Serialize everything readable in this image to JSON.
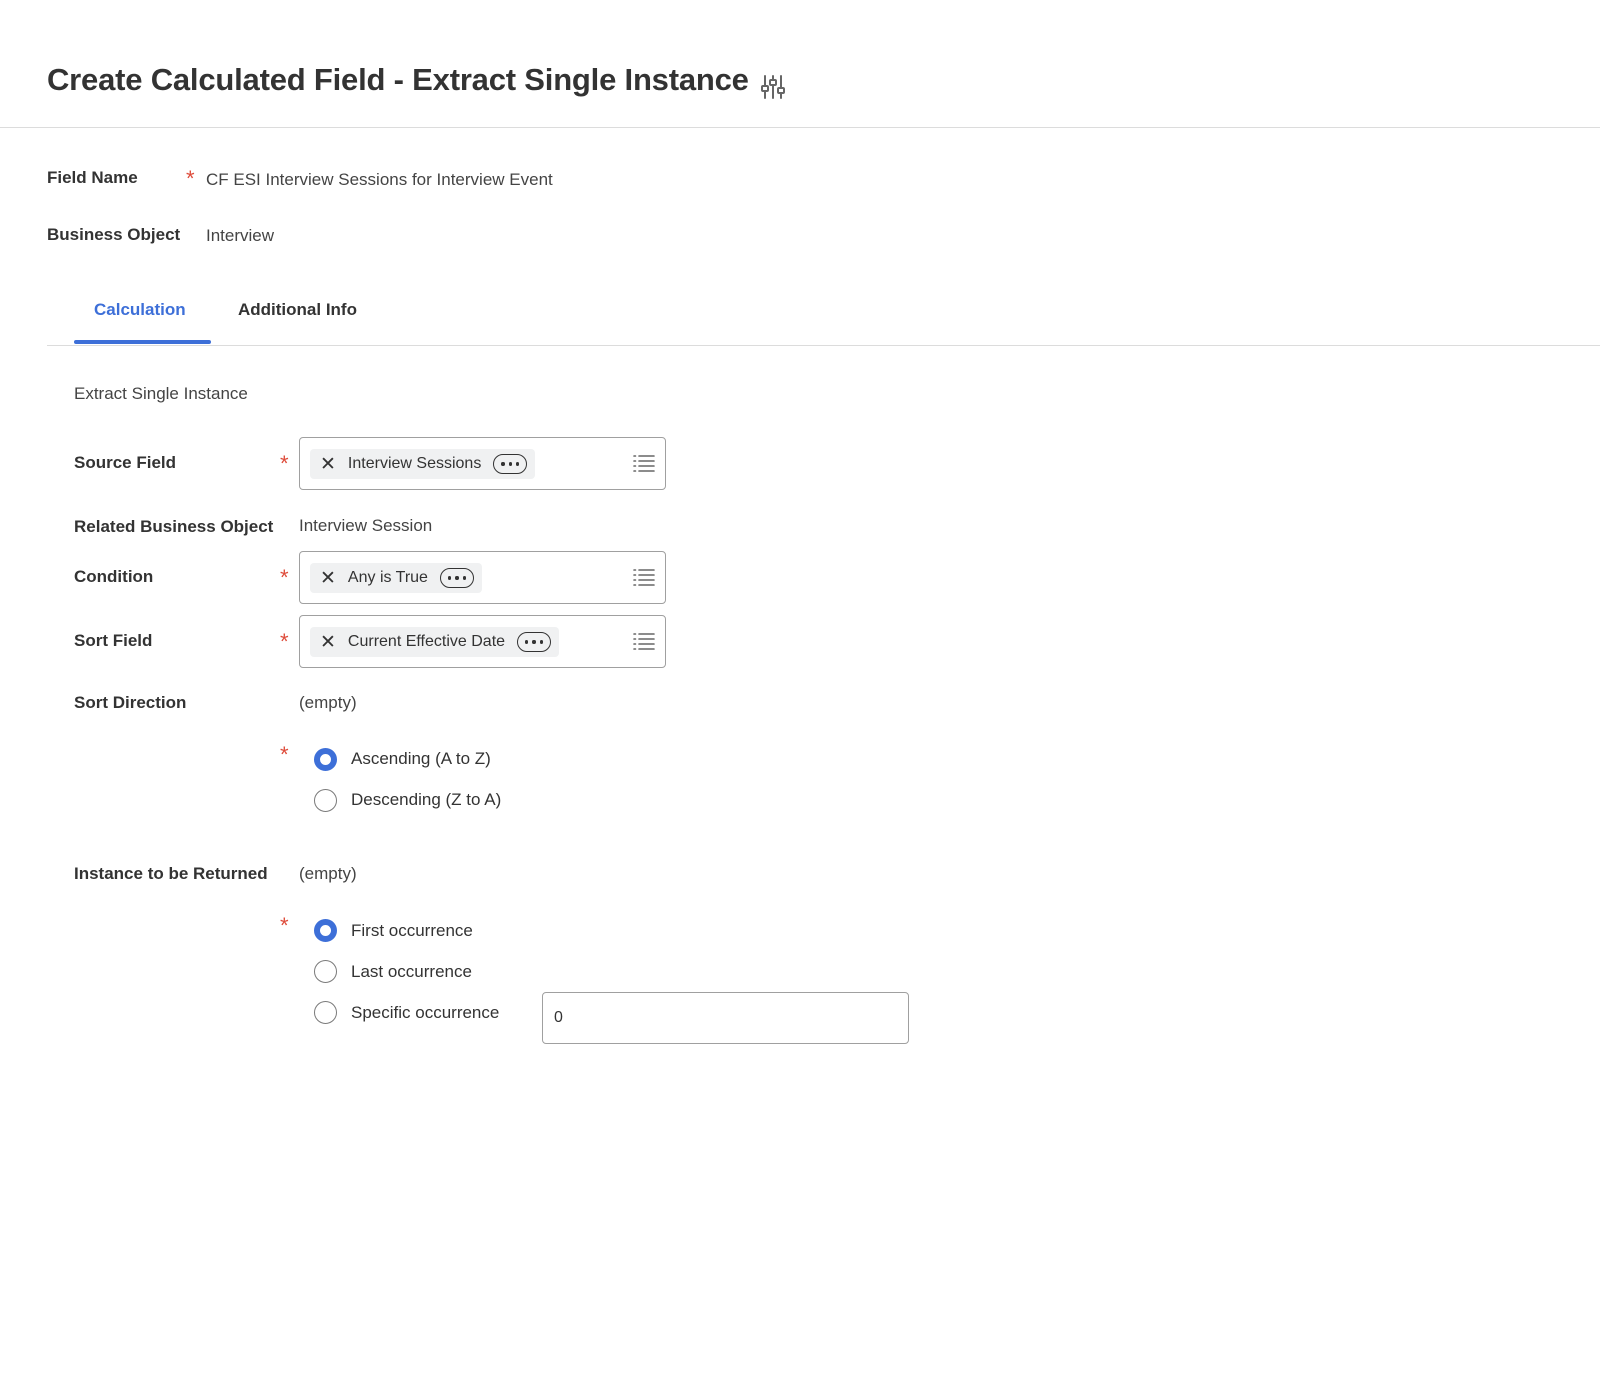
{
  "header": {
    "title": "Create Calculated Field - Extract Single Instance",
    "actions_icon": "related-actions-sliders-icon"
  },
  "form": {
    "field_name": {
      "label": "Field Name",
      "value": "CF ESI Interview Sessions for Interview Event"
    },
    "business_object": {
      "label": "Business Object",
      "value": "Interview"
    }
  },
  "tabs": [
    {
      "label": "Calculation",
      "active": true
    },
    {
      "label": "Additional Info",
      "active": false
    }
  ],
  "calculation": {
    "section_title": "Extract Single Instance",
    "source_field": {
      "label": "Source Field",
      "value": "Interview Sessions"
    },
    "related_business_object": {
      "label": "Related Business Object",
      "value": "Interview Session"
    },
    "condition": {
      "label": "Condition",
      "value": "Any is True"
    },
    "sort_field": {
      "label": "Sort Field",
      "value": "Current Effective Date"
    },
    "sort_direction": {
      "label": "Sort Direction",
      "empty_text": "(empty)",
      "options": [
        "Ascending (A to Z)",
        "Descending (Z to A)"
      ],
      "selected": "Ascending (A to Z)"
    },
    "instance_returned": {
      "label": "Instance to be Returned",
      "empty_text": "(empty)",
      "options": [
        "First occurrence",
        "Last occurrence",
        "Specific occurrence"
      ],
      "selected": "First occurrence",
      "specific_value": "0"
    }
  },
  "colors": {
    "accent": "#3d6fd8",
    "required": "#de4b3a",
    "text": "#333333",
    "border": "#a0a0a0"
  }
}
